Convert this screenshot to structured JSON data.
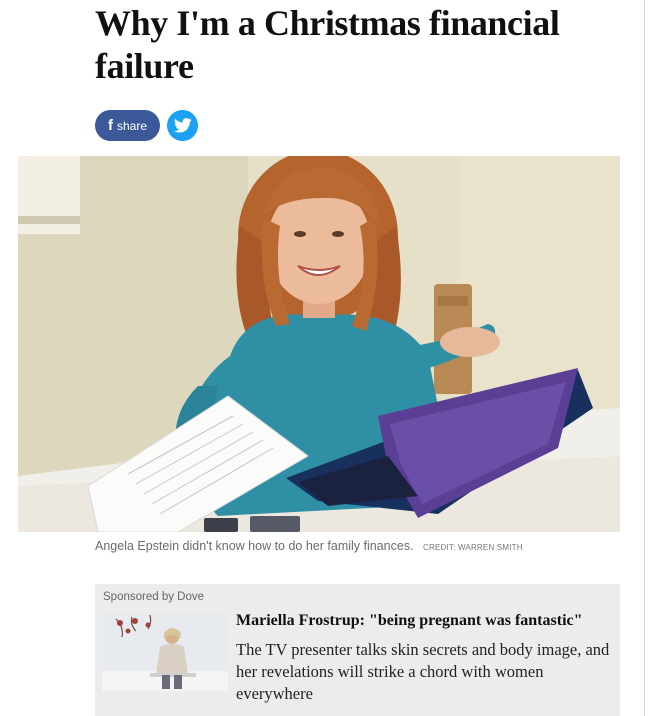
{
  "article": {
    "headline": "Why I'm a Christmas financial failure",
    "share": {
      "facebook_label": "share",
      "facebook_icon": "f",
      "twitter_icon": "twitter-bird-icon"
    },
    "image": {
      "caption": "Angela Epstein didn't know how to do her family finances.",
      "credit": "CREDIT: WARREN SMITH"
    }
  },
  "promo": {
    "sponsor_label": "Sponsored by Dove",
    "title": "Mariella Frostrup: \"being pregnant was fantastic\"",
    "body": "The TV presenter talks skin secrets and body image, and her revelations will strike a chord with women everywhere"
  },
  "colors": {
    "facebook": "#3b5998",
    "twitter": "#1da1f2",
    "promo_background": "#ececec"
  }
}
